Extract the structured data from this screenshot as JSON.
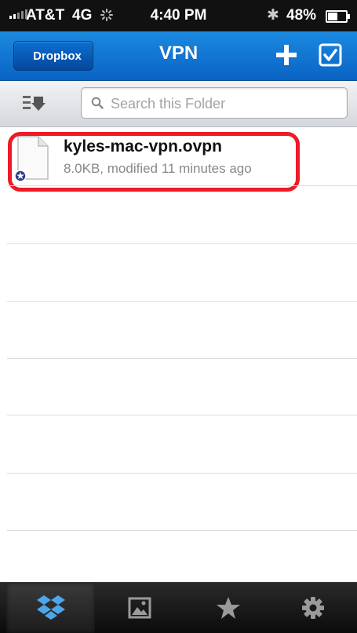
{
  "status_bar": {
    "carrier": "AT&T",
    "network": "4G",
    "time": "4:40 PM",
    "battery_percent": "48%",
    "battery_level": 0.48
  },
  "nav": {
    "back_label": "Dropbox",
    "title": "VPN"
  },
  "search": {
    "placeholder": "Search this Folder",
    "value": ""
  },
  "files": [
    {
      "name": "kyles-mac-vpn.ovpn",
      "meta": "8.0KB, modified 11 minutes ago",
      "icon": "document-icon",
      "badge": "star-badge-icon"
    }
  ],
  "tabs": [
    {
      "icon": "dropbox-icon",
      "selected": true
    },
    {
      "icon": "photos-icon",
      "selected": false
    },
    {
      "icon": "favorites-star-icon",
      "selected": false
    },
    {
      "icon": "settings-gear-icon",
      "selected": false
    }
  ],
  "colors": {
    "nav_blue": "#0a63c4",
    "highlight_red": "#ee1b24",
    "tab_bar": "#111111"
  }
}
